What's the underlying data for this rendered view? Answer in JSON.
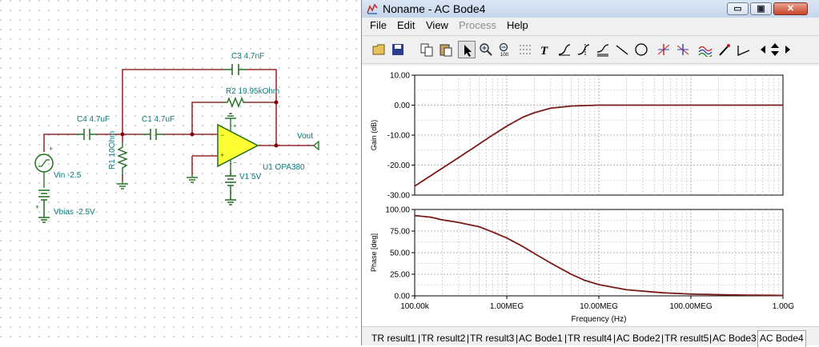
{
  "schematic": {
    "labels": {
      "c3": "C3 4.7nF",
      "r2": "R2 19.95kOhm",
      "c4": "C4 4.7uF",
      "c1": "C1 4.7uF",
      "r1": "R1 10Ohm",
      "vout": "Vout",
      "u1": "U1 OPA380",
      "v1": "V1 5V",
      "vin": "Vin -2.5",
      "vbias": "Vbias -2.5V"
    },
    "colors": {
      "wire": "#800000",
      "component": "#1e6e1e",
      "label": "#0a7a7a",
      "opamp_fill": "#ffff33"
    }
  },
  "window": {
    "title": "Noname - AC Bode4",
    "buttons": {
      "minimize": "▭",
      "maximize": "▣",
      "close": "✕"
    },
    "menu": [
      {
        "label": "File",
        "enabled": true
      },
      {
        "label": "Edit",
        "enabled": true
      },
      {
        "label": "View",
        "enabled": true
      },
      {
        "label": "Process",
        "enabled": false
      },
      {
        "label": "Help",
        "enabled": true
      }
    ],
    "toolbar_icons": [
      "open-icon",
      "save-icon",
      "copy-icon",
      "paste-icon",
      "pointer-icon",
      "zoom-in-icon",
      "zoom-100-icon",
      "grid-icon",
      "text-icon",
      "curve-icon",
      "cursor-a-icon",
      "cursor-b-icon",
      "line-icon",
      "circle-icon",
      "marker-icon",
      "marker2-icon",
      "waveform-icon",
      "pen-icon",
      "step-icon",
      "arrow-left-icon",
      "arrow-updown-icon",
      "arrow-right-icon"
    ],
    "tabs": [
      "TR result1",
      "TR result2",
      "TR result3",
      "AC Bode1",
      "TR result4",
      "AC Bode2",
      "TR result5",
      "AC Bode3",
      "AC Bode4"
    ],
    "active_tab": "AC Bode4"
  },
  "chart_data": [
    {
      "type": "line",
      "title": "",
      "xlabel": "",
      "ylabel": "Gain (dB)",
      "xscale": "log",
      "xlim": [
        100000,
        1000000000
      ],
      "ylim": [
        -30,
        10
      ],
      "yticks": [
        "10.00",
        "0.00",
        "-10.00",
        "-20.00",
        "-30.00"
      ],
      "ytick_values": [
        10,
        0,
        -10,
        -20,
        -30
      ],
      "grid": true,
      "color": "#7a1a1a",
      "series": [
        {
          "x": [
            100000,
            150000,
            200000,
            300000,
            500000,
            700000,
            1000000,
            1500000,
            2000000,
            3000000,
            5000000,
            10000000,
            100000000,
            1000000000
          ],
          "y": [
            -27,
            -23.5,
            -21,
            -17.5,
            -13,
            -10,
            -7,
            -4,
            -2.5,
            -1,
            -0.3,
            0,
            0,
            0
          ]
        }
      ]
    },
    {
      "type": "line",
      "title": "",
      "xlabel": "Frequency (Hz)",
      "ylabel": "Phase [deg]",
      "xscale": "log",
      "xlim": [
        100000,
        1000000000
      ],
      "ylim": [
        0,
        100
      ],
      "xticks": [
        "100.00k",
        "1.00MEG",
        "10.00MEG",
        "100.00MEG",
        "1.00G"
      ],
      "xtick_values": [
        100000,
        1000000,
        10000000,
        100000000,
        1000000000
      ],
      "yticks": [
        "100.00",
        "75.00",
        "50.00",
        "25.00",
        "0.00"
      ],
      "ytick_values": [
        100,
        75,
        50,
        25,
        0
      ],
      "grid": true,
      "color": "#7a1a1a",
      "series": [
        {
          "x": [
            100000,
            150000,
            200000,
            300000,
            500000,
            700000,
            1000000,
            1500000,
            2000000,
            3000000,
            5000000,
            7000000,
            10000000,
            20000000,
            50000000,
            100000000,
            300000000,
            1000000000
          ],
          "y": [
            93,
            91,
            88,
            85,
            80,
            74,
            67,
            57,
            49,
            38,
            25,
            18,
            13,
            7,
            3.5,
            2,
            1,
            0.5
          ]
        }
      ]
    }
  ]
}
